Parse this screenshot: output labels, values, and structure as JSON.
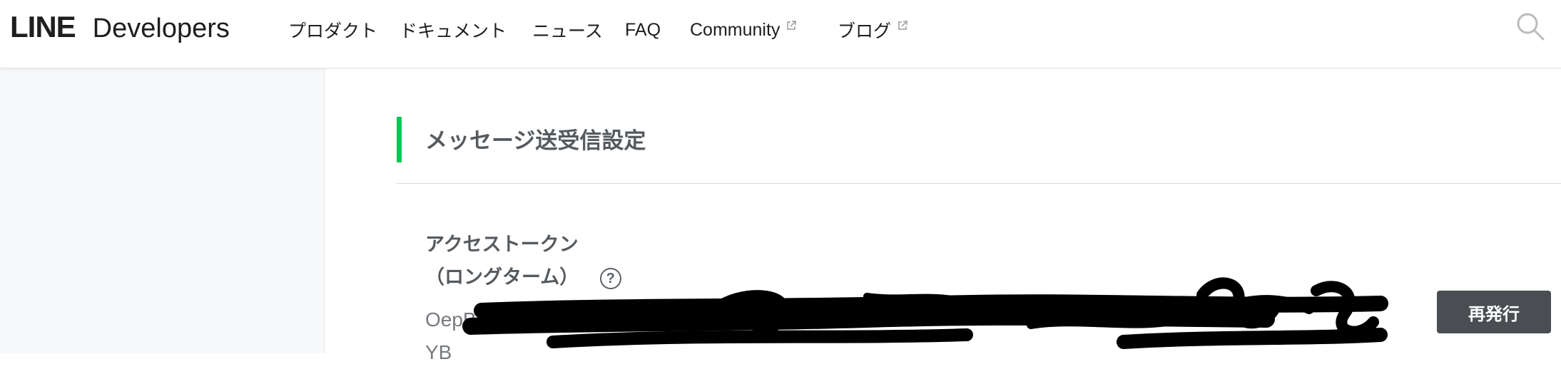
{
  "header": {
    "logo_line": "LINE",
    "logo_developers": "Developers",
    "nav": [
      {
        "label": "プロダクト",
        "external": false
      },
      {
        "label": "ドキュメント",
        "external": false
      },
      {
        "label": "ニュース",
        "external": false
      },
      {
        "label": "FAQ",
        "external": false
      },
      {
        "label": "Community",
        "external": true
      },
      {
        "label": "ブログ",
        "external": true
      }
    ],
    "search_icon": "search-icon"
  },
  "section": {
    "title": "メッセージ送受信設定",
    "accent_color": "#06c755"
  },
  "access_token": {
    "label_line1": "アクセストークン",
    "label_line2": "（ロングターム）",
    "help_glyph": "?",
    "token_line1": "OepBestorT",
    "token_line2": "YB",
    "redacted": true
  },
  "reissue_button": {
    "label": "再発行"
  }
}
